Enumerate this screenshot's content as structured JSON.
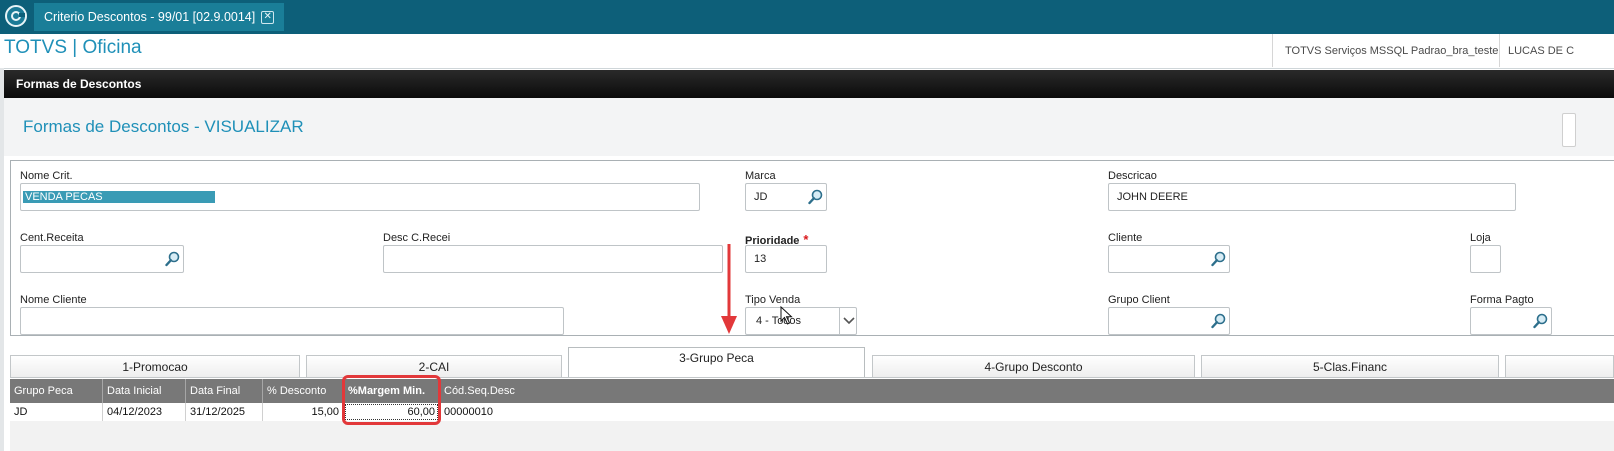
{
  "window": {
    "tab_title": "Criterio Descontos - 99/01 [02.9.0014]",
    "close_glyph": "✕"
  },
  "app": {
    "brand": "TOTVS | Oficina",
    "server": "TOTVS Serviços MSSQL Padrao_bra_teste",
    "user": "LUCAS DE C"
  },
  "form": {
    "header": "Formas de Descontos",
    "title": "Formas de Descontos - VISUALIZAR"
  },
  "fields": {
    "nome_crit": {
      "label": "Nome Crit.",
      "value": "VENDA PECAS"
    },
    "marca": {
      "label": "Marca",
      "value": "JD"
    },
    "descricao": {
      "label": "Descricao",
      "value": "JOHN DEERE"
    },
    "cent_receita": {
      "label": "Cent.Receita",
      "value": ""
    },
    "desc_c_recei": {
      "label": "Desc C.Recei",
      "value": ""
    },
    "prioridade": {
      "label": "Prioridade",
      "required_mark": "*",
      "value": "13"
    },
    "cliente": {
      "label": "Cliente",
      "value": ""
    },
    "loja": {
      "label": "Loja",
      "value": ""
    },
    "nome_cliente": {
      "label": "Nome Cliente",
      "value": ""
    },
    "tipo_venda": {
      "label": "Tipo Venda",
      "value": "4 - Todos"
    },
    "grupo_client": {
      "label": "Grupo Client",
      "value": ""
    },
    "forma_pagto": {
      "label": "Forma Pagto",
      "value": ""
    }
  },
  "tabs": [
    {
      "label": "1-Promocao",
      "active": false
    },
    {
      "label": "2-CAI",
      "active": false
    },
    {
      "label": "3-Grupo Peca",
      "active": true
    },
    {
      "label": "4-Grupo Desconto",
      "active": false
    },
    {
      "label": "5-Clas.Financ",
      "active": false
    }
  ],
  "grid": {
    "columns": [
      "Grupo Peca",
      "Data Inicial",
      "Data Final",
      "% Desconto",
      "%Margem Min.",
      "Cód.Seq.Desc"
    ],
    "rows": [
      [
        "JD",
        "04/12/2023",
        "31/12/2025",
        "15,00",
        "60,00",
        "00000010"
      ]
    ]
  },
  "colors": {
    "titlebar": "#0d5f79",
    "accent": "#1f90b8",
    "annotation": "#e2383a"
  },
  "icons": [
    "totvs-logo-icon",
    "close-icon",
    "search-icon",
    "chevron-down-icon",
    "mouse-cursor-icon",
    "annotation-arrow-icon"
  ]
}
